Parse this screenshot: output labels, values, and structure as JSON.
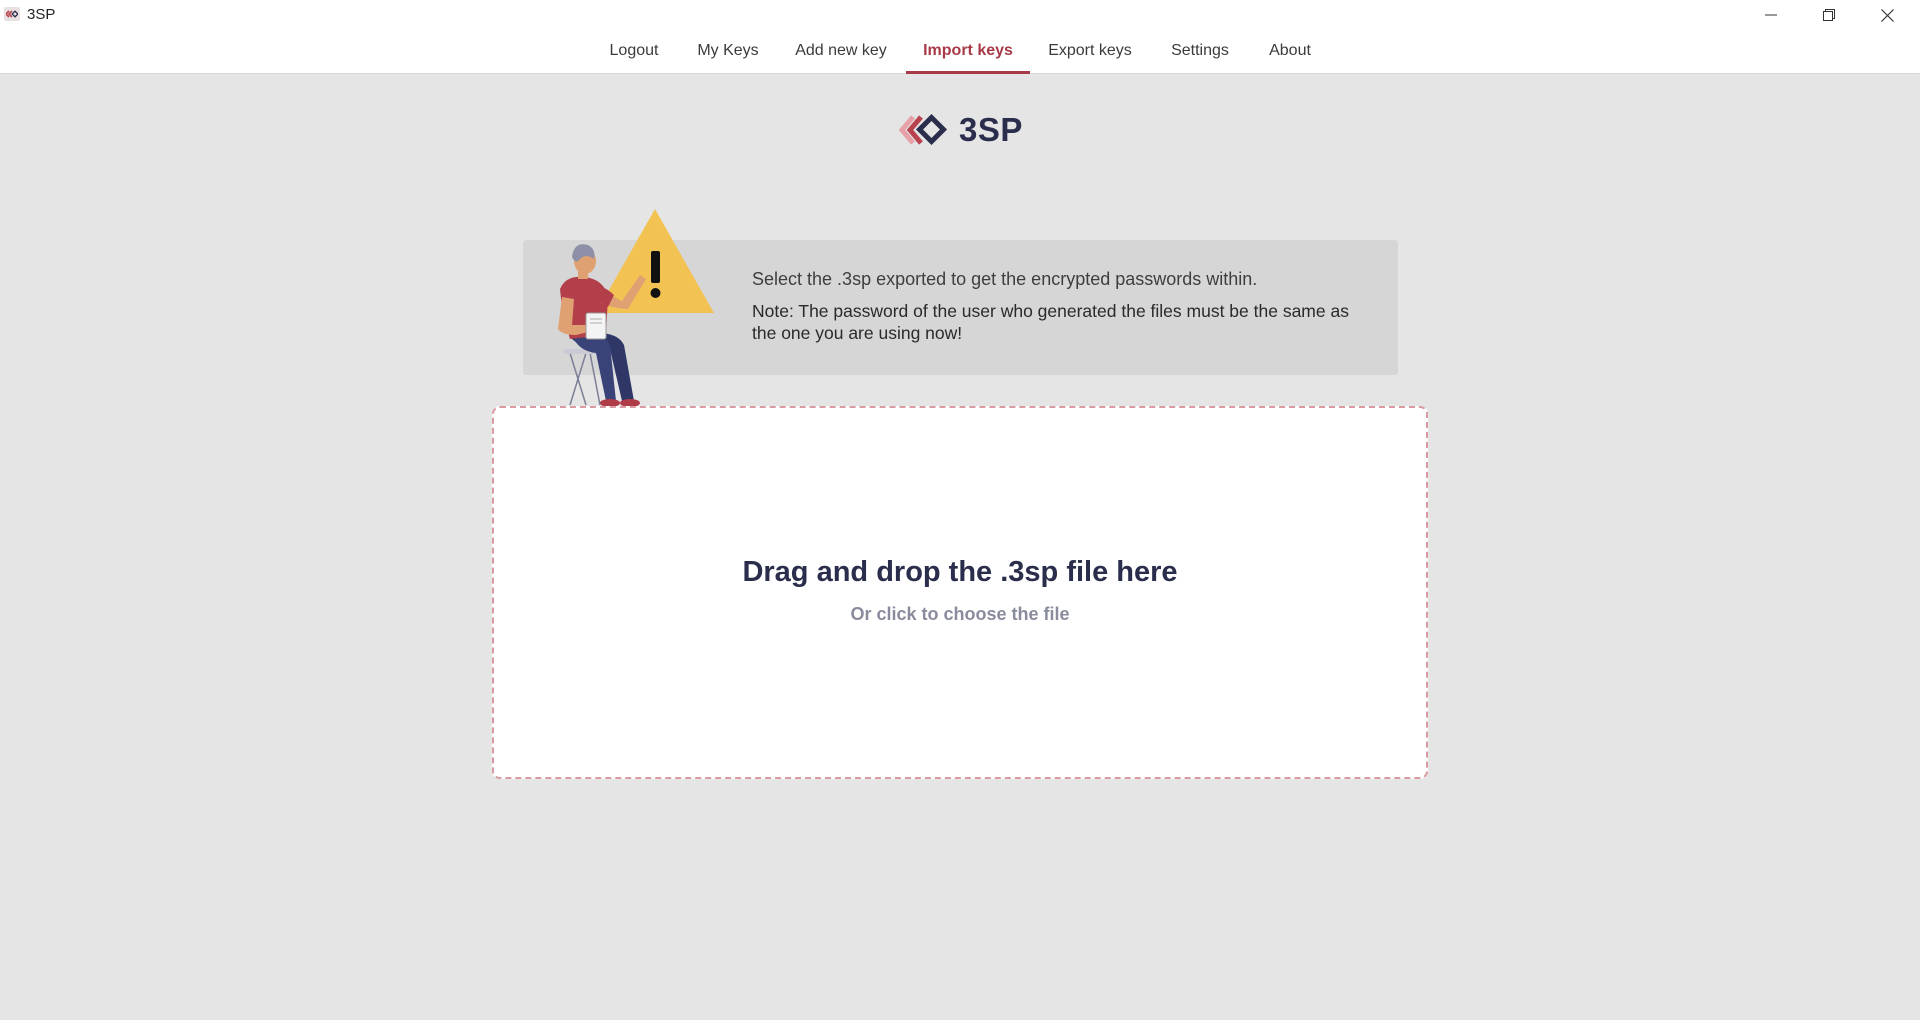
{
  "window": {
    "title": "3SP",
    "icons": [
      "app-icon",
      "minimize-icon",
      "restore-icon",
      "close-icon"
    ]
  },
  "nav": {
    "items": [
      {
        "label": "Logout"
      },
      {
        "label": "My Keys"
      },
      {
        "label": "Add new key"
      },
      {
        "label": "Import keys",
        "active": true
      },
      {
        "label": "Export keys"
      },
      {
        "label": "Settings"
      },
      {
        "label": "About"
      }
    ]
  },
  "logo": {
    "text": "3SP"
  },
  "notice": {
    "line1": "Select the .3sp exported to get the encrypted passwords within.",
    "line2": "Note: The password of the user who generated the files must be the same as the one you are using now!"
  },
  "dropzone": {
    "title": "Drag and drop the .3sp file here",
    "subtitle": "Or click to choose the file"
  },
  "colors": {
    "accent": "#a83a47",
    "brand_dark": "#2a2d4b",
    "warning_yellow": "#f2c353",
    "background": "#e5e5e5"
  }
}
